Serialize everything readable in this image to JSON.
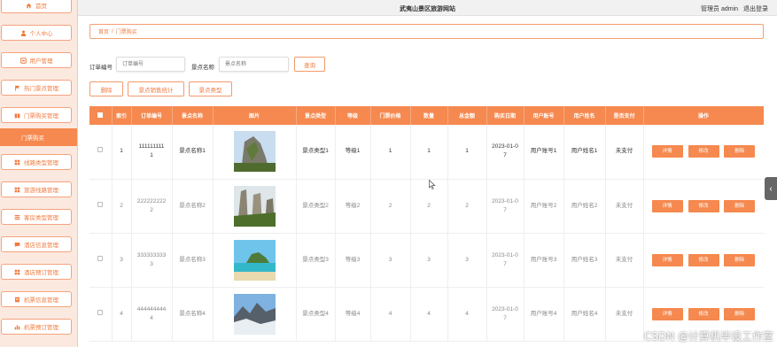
{
  "header": {
    "title": "武夷山景区旅游网站",
    "role": "管理员 admin",
    "logout": "退出登录"
  },
  "sidebar": {
    "items": [
      {
        "label": "首页",
        "icon": "home-icon"
      },
      {
        "label": "个人中心",
        "icon": "user-icon"
      },
      {
        "label": "用户管理",
        "icon": "users-icon"
      },
      {
        "label": "热门景点管理",
        "icon": "flag-icon"
      },
      {
        "label": "门票购买管理",
        "icon": "ticket-icon"
      },
      {
        "label": "线路类型管理",
        "icon": "grid-icon"
      },
      {
        "label": "旅游线路管理",
        "icon": "grid-icon"
      },
      {
        "label": "客房类型管理",
        "icon": "list-icon"
      },
      {
        "label": "酒店信息管理",
        "icon": "chat-icon"
      },
      {
        "label": "酒店预订管理",
        "icon": "grid-icon"
      },
      {
        "label": "机票信息管理",
        "icon": "doc-icon"
      },
      {
        "label": "机票预订管理",
        "icon": "bar-chart-icon"
      }
    ],
    "sub_active": "门票购买"
  },
  "breadcrumb": {
    "home": "首页",
    "sep": "/",
    "current": "门票购买"
  },
  "search": {
    "order_label": "订单编号",
    "order_placeholder": "订单编号",
    "spot_label": "景点名称",
    "spot_placeholder": "景点名称",
    "query_btn": "查询"
  },
  "actions": {
    "delete": "删除",
    "stats": "景点销售统计",
    "type": "景点类型"
  },
  "table": {
    "headers": [
      "",
      "索引",
      "订单编号",
      "景点名称",
      "图片",
      "景点类型",
      "等级",
      "门票价格",
      "数量",
      "总金额",
      "购买日期",
      "用户账号",
      "用户姓名",
      "是否支付",
      "操作"
    ],
    "row_buttons": {
      "detail": "详情",
      "edit": "修改",
      "delete": "删除"
    },
    "rows": [
      {
        "index": "1",
        "order_a": "111111111",
        "order_b": "1",
        "spot": "景点名称1",
        "type": "景点类型1",
        "level": "等级1",
        "price": "1",
        "qty": "1",
        "total": "1",
        "date_a": "2023-01-0",
        "date_b": "7",
        "account": "用户账号1",
        "name": "用户姓名1",
        "paid": "未支付",
        "pic": "cliff"
      },
      {
        "index": "2",
        "order_a": "222222222",
        "order_b": "2",
        "spot": "景点名称2",
        "type": "景点类型2",
        "level": "等级2",
        "price": "2",
        "qty": "2",
        "total": "2",
        "date_a": "2023-01-0",
        "date_b": "7",
        "account": "用户账号2",
        "name": "用户姓名2",
        "paid": "未支付",
        "pic": "pillars"
      },
      {
        "index": "3",
        "order_a": "333333333",
        "order_b": "3",
        "spot": "景点名称3",
        "type": "景点类型3",
        "level": "等级3",
        "price": "3",
        "qty": "3",
        "total": "3",
        "date_a": "2023-01-0",
        "date_b": "7",
        "account": "用户账号3",
        "name": "用户姓名3",
        "paid": "未支付",
        "pic": "lagoon"
      },
      {
        "index": "4",
        "order_a": "444444444",
        "order_b": "4",
        "spot": "景点名称4",
        "type": "景点类型4",
        "level": "等级4",
        "price": "4",
        "qty": "4",
        "total": "4",
        "date_a": "2023-01-0",
        "date_b": "7",
        "account": "用户账号4",
        "name": "用户姓名4",
        "paid": "未支付",
        "pic": "peaks"
      }
    ]
  },
  "watermark": "CSDN @计算机毕设工作室",
  "colors": {
    "accent": "#f5894f",
    "accent_text": "#f07a3e",
    "sidebar_bg": "#fbe9df"
  }
}
